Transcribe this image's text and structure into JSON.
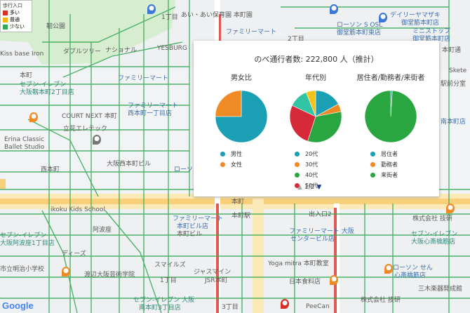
{
  "legend": {
    "title": "歩行入口",
    "items": [
      {
        "label": "多い",
        "color": "#d93025"
      },
      {
        "label": "普通",
        "color": "#f4b400"
      },
      {
        "label": "少ない",
        "color": "#34a853"
      }
    ]
  },
  "map_labels": [
    {
      "text": "あい・あい保育園 本町園",
      "cls": "dark"
    },
    {
      "text": "デイリーヤマザキ",
      "cls": "blue"
    },
    {
      "text": "御堂筋本町店",
      "cls": "blue"
    },
    {
      "text": "ローソン S OSL",
      "cls": "blue"
    },
    {
      "text": "御堂筋本町東店",
      "cls": "blue"
    },
    {
      "text": "ミニストップ",
      "cls": "blue"
    },
    {
      "text": "御堂筋本町店",
      "cls": "blue"
    },
    {
      "text": "ファミリーマート",
      "cls": "blue"
    },
    {
      "text": "靭公園",
      "cls": "dark"
    },
    {
      "text": "ダブルツリー",
      "cls": "dark"
    },
    {
      "text": "ナショナル",
      "cls": "dark"
    },
    {
      "text": "YESBURG",
      "cls": "dark"
    },
    {
      "text": "ファミリーマート",
      "cls": "blue"
    },
    {
      "text": "Kiss base Iron",
      "cls": "dark"
    },
    {
      "text": "本町",
      "cls": "dark"
    },
    {
      "text": "セブン-イレブン",
      "cls": "teal"
    },
    {
      "text": "大阪靱本町2丁目店",
      "cls": "teal"
    },
    {
      "text": "ファミリーマート",
      "cls": "blue"
    },
    {
      "text": "西本町一丁目店",
      "cls": "blue"
    },
    {
      "text": "COURT NEXT 本町",
      "cls": "dark"
    },
    {
      "text": "立花エレテック",
      "cls": "dark"
    },
    {
      "text": "Erina Classic",
      "cls": "dark"
    },
    {
      "text": "Ballet Studio",
      "cls": "dark"
    },
    {
      "text": "西本町",
      "cls": "dark"
    },
    {
      "text": "大阪西本町ビル",
      "cls": "dark"
    },
    {
      "text": "ローソン",
      "cls": "blue"
    },
    {
      "text": "ikoku Kids School",
      "cls": "dark"
    },
    {
      "text": "ファミリーマート",
      "cls": "blue"
    },
    {
      "text": "本町ビル店",
      "cls": "blue"
    },
    {
      "text": "阿波座",
      "cls": "dark"
    },
    {
      "text": "セブン-イレブン",
      "cls": "teal"
    },
    {
      "text": "大阪阿波座1丁目店",
      "cls": "teal"
    },
    {
      "text": "ディーズ",
      "cls": "dark"
    },
    {
      "text": "市立明治小学校",
      "cls": "dark"
    },
    {
      "text": "渡辺大阪芸術学院",
      "cls": "dark"
    },
    {
      "text": "スマイルズ",
      "cls": "dark"
    },
    {
      "text": "ジャスマイン",
      "cls": "dark"
    },
    {
      "text": "JSR本町",
      "cls": "dark"
    },
    {
      "text": "Yoga mitra 本町教室",
      "cls": "dark"
    },
    {
      "text": "日本食料店",
      "cls": "dark"
    },
    {
      "text": "ファミリーマート 大阪",
      "cls": "blue"
    },
    {
      "text": "センタービル店",
      "cls": "blue"
    },
    {
      "text": "出入口2",
      "cls": "dark"
    },
    {
      "text": "株式会社 技研",
      "cls": "dark"
    },
    {
      "text": "セブン-イレブン",
      "cls": "teal"
    },
    {
      "text": "大阪心斎橋筋店",
      "cls": "teal"
    },
    {
      "text": "ローソン せん",
      "cls": "blue"
    },
    {
      "text": "心斎橋筋店",
      "cls": "blue"
    },
    {
      "text": "三木楽器開成館",
      "cls": "dark"
    },
    {
      "text": "株式会社 技研",
      "cls": "dark"
    },
    {
      "text": "セブン-イレブン 大阪",
      "cls": "teal"
    },
    {
      "text": "南本町3丁目店",
      "cls": "teal"
    },
    {
      "text": "PeeCan",
      "cls": "dark"
    },
    {
      "text": "1丁目",
      "cls": "dark"
    },
    {
      "text": "2丁目",
      "cls": "dark"
    },
    {
      "text": "3丁目",
      "cls": "dark"
    },
    {
      "text": "1丁目",
      "cls": "dark"
    },
    {
      "text": "Skete",
      "cls": "dark"
    },
    {
      "text": "本町通",
      "cls": "dark"
    },
    {
      "text": "駅前分室",
      "cls": "dark"
    },
    {
      "text": "南本町店",
      "cls": "blue"
    },
    {
      "text": "本町ビル",
      "cls": "dark"
    },
    {
      "text": "本町駅",
      "cls": "dark"
    },
    {
      "text": "本町",
      "cls": "dark"
    }
  ],
  "popup": {
    "title": "のべ通行者数: 222,800 人（推計）",
    "pager": {
      "up": "▲",
      "page": "1/2",
      "down": "▼"
    }
  },
  "chart_data": [
    {
      "type": "pie",
      "title": "男女比",
      "slices": [
        {
          "label": "男性",
          "value": 75,
          "color": "#1a9fb5"
        },
        {
          "label": "女性",
          "value": 25,
          "color": "#f08a24"
        }
      ]
    },
    {
      "type": "pie",
      "title": "年代別",
      "slices": [
        {
          "label": "20代",
          "value": 17,
          "color": "#1a9fb5"
        },
        {
          "label": "30代",
          "value": 5,
          "color": "#f08a24"
        },
        {
          "label": "40代",
          "value": 33,
          "color": "#2aa640"
        },
        {
          "label": "50代",
          "value": 27,
          "color": "#d62a3a"
        },
        {
          "label": "",
          "value": 12,
          "color": "#31c5a5"
        },
        {
          "label": "",
          "value": 6,
          "color": "#f5c21a"
        }
      ]
    },
    {
      "type": "pie",
      "title": "居住者/勤務者/来街者",
      "slices": [
        {
          "label": "居住者",
          "value": 1,
          "color": "#1a9fb5"
        },
        {
          "label": "勤務者",
          "value": 0,
          "color": "#f08a24"
        },
        {
          "label": "来街者",
          "value": 99,
          "color": "#2aa640"
        }
      ]
    }
  ],
  "google_logo": "Google"
}
